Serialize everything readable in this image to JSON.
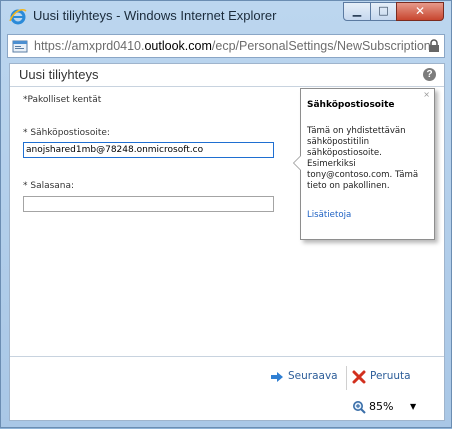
{
  "window": {
    "title": "Uusi tiliyhteys - Windows Internet Explorer",
    "min_glyph": "▁",
    "max_glyph": "□",
    "close_glyph": "✕"
  },
  "address": {
    "prefix": "https://amxprd0410.",
    "domain": "outlook.com",
    "path": "/ecp/PersonalSettings/NewSubscription"
  },
  "dialog": {
    "title": "Uusi tiliyhteys",
    "help_glyph": "?",
    "required_note": "*Pakolliset kentät",
    "email_label": "* Sähköpostiosoite:",
    "email_value": "anojshared1mb@78248.onmicrosoft.co",
    "password_label": "* Salasana:",
    "password_value": ""
  },
  "callout": {
    "close_glyph": "×",
    "title": "Sähköpostiosoite",
    "text": "Tämä on yhdistettävän sähköpostitilin sähköpostiosoite. Esimerkiksi tony@contoso.com. Tämä tieto on pakollinen.",
    "link": "Lisätietoja"
  },
  "footer": {
    "next_label": "Seuraava",
    "cancel_label": "Peruuta"
  },
  "status": {
    "zoom": "85%",
    "zoom_dropdown_glyph": "▼"
  },
  "colors": {
    "accent_link": "#2063c4",
    "next_arrow": "#2f7fd3",
    "cancel_x": "#d2301e"
  }
}
